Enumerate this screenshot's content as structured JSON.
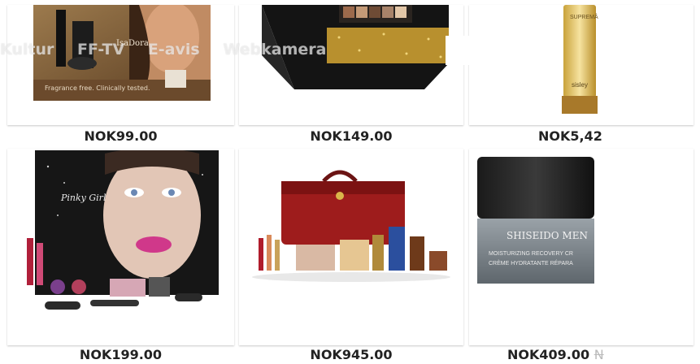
{
  "overlay_nav": [
    "Kultur",
    "FF-TV",
    "E-avis",
    "Webkamera"
  ],
  "products": [
    {
      "image": "isadora-makeup-gift-box",
      "price": "NOK99.00"
    },
    {
      "image": "black-gold-eyeshadow-palette-box",
      "price": "NOK149.00"
    },
    {
      "image": "sisley-gold-serum-bottle",
      "price": "NOK5,42"
    },
    {
      "image": "makeup-advent-calendar-box",
      "price": "NOK199.00"
    },
    {
      "image": "red-vanity-case-makeup-set",
      "price": "NOK945.00"
    },
    {
      "image": "shiseido-men-cream-jar",
      "price": "NOK409.00",
      "old_price": "N"
    }
  ],
  "image_text": {
    "isadora": "IsaDora",
    "fragrance": "Fragrance free. Clinically tested.",
    "sisley_side": "SUPREMÂ",
    "sisley_brand": "sisley",
    "calendar_script": "Pinky Girl",
    "shiseido_brand": "SHISEIDO MEN",
    "shiseido_line1": "MOISTURIZING RECOVERY CR",
    "shiseido_line2": "CRÈME HYDRATANTE RÉPARA"
  }
}
